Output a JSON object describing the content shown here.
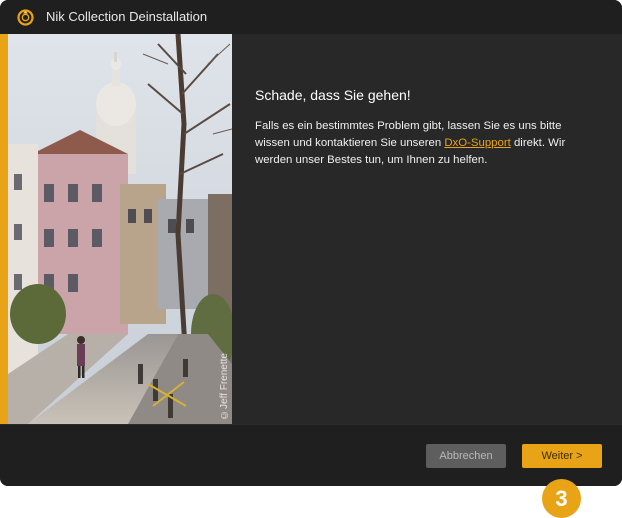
{
  "window": {
    "title": "Nik Collection Deinstallation",
    "accent_color": "#e8a317",
    "background_color": "#1f1f1f"
  },
  "photo": {
    "credit": "©Jeff Frenette"
  },
  "main": {
    "heading": "Schade, dass Sie gehen!",
    "body_before_link": "Falls es ein bestimmtes Problem gibt, lassen Sie es uns bitte wissen und kontaktieren Sie unseren ",
    "link_text": "DxO-Support",
    "body_after_link": " direkt. Wir werden unser Bestes tun, um Ihnen zu helfen."
  },
  "footer": {
    "cancel_label": "Abbrechen",
    "next_label": "Weiter >"
  },
  "step_badge": "3",
  "icons": {
    "app": "nik-collection-logo-icon"
  }
}
